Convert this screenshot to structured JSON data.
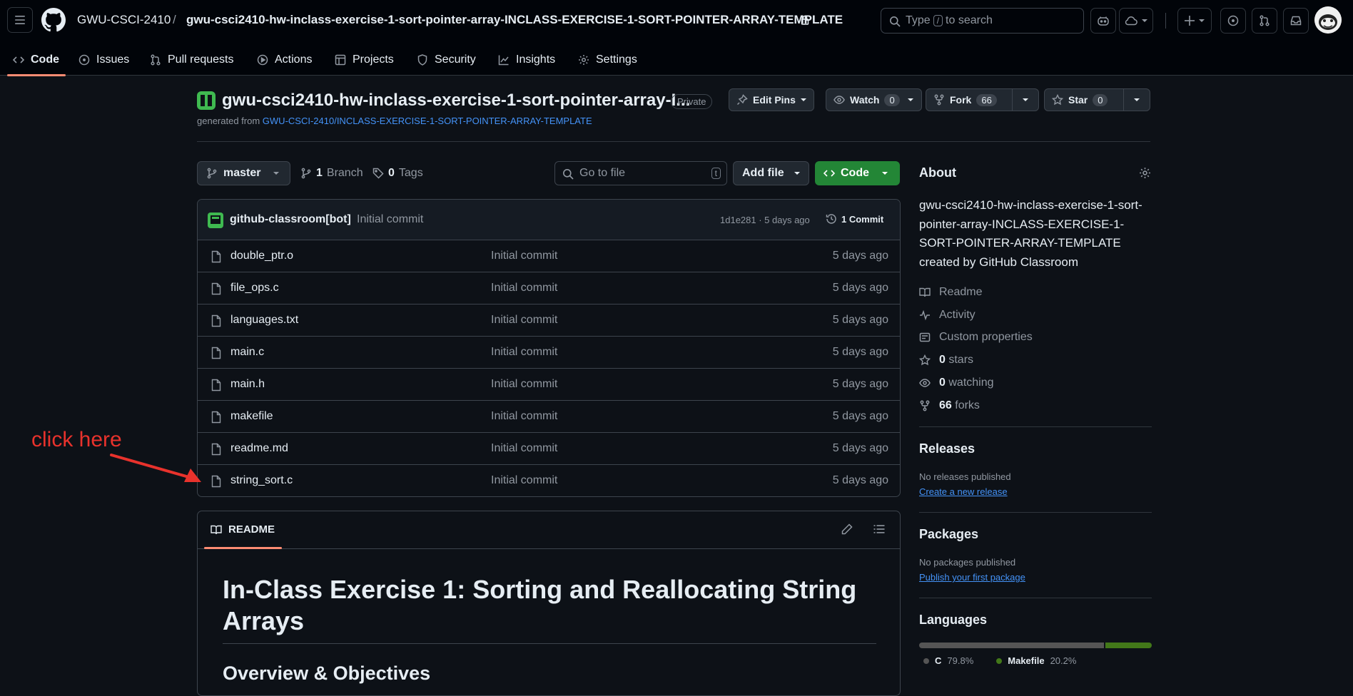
{
  "header": {
    "org": "GWU-CSCI-2410",
    "separator": "/",
    "repo": "gwu-csci2410-hw-inclass-exercise-1-sort-pointer-array-INCLASS-EXERCISE-1-SORT-POINTER-ARRAY-TEMPLATE",
    "search_pre": "Type",
    "search_key": "/",
    "search_post": "to search"
  },
  "nav": {
    "code": "Code",
    "issues": "Issues",
    "pulls": "Pull requests",
    "actions": "Actions",
    "projects": "Projects",
    "security": "Security",
    "insights": "Insights",
    "settings": "Settings"
  },
  "repo": {
    "title": "gwu-csci2410-hw-inclass-exercise-1-sort-pointer-array-I...",
    "visibility": "Private",
    "generated_prefix": "generated from",
    "generated_link": "GWU-CSCI-2410/INCLASS-EXERCISE-1-SORT-POINTER-ARRAY-TEMPLATE",
    "edit_pins": "Edit Pins",
    "watch": "Watch",
    "watch_count": "0",
    "fork": "Fork",
    "fork_count": "66",
    "star": "Star",
    "star_count": "0"
  },
  "toolbar": {
    "branch": "master",
    "branches_count": "1",
    "branches_label": "Branch",
    "tags_count": "0",
    "tags_label": "Tags",
    "goto_placeholder": "Go to file",
    "goto_key": "t",
    "add_file": "Add file",
    "code": "Code"
  },
  "commit": {
    "author": "github-classroom[bot]",
    "message": "Initial commit",
    "hash_time": "1d1e281 · 5 days ago",
    "count": "1 Commit"
  },
  "files": [
    {
      "name": "double_ptr.o",
      "msg": "Initial commit",
      "date": "5 days ago"
    },
    {
      "name": "file_ops.c",
      "msg": "Initial commit",
      "date": "5 days ago"
    },
    {
      "name": "languages.txt",
      "msg": "Initial commit",
      "date": "5 days ago"
    },
    {
      "name": "main.c",
      "msg": "Initial commit",
      "date": "5 days ago"
    },
    {
      "name": "main.h",
      "msg": "Initial commit",
      "date": "5 days ago"
    },
    {
      "name": "makefile",
      "msg": "Initial commit",
      "date": "5 days ago"
    },
    {
      "name": "readme.md",
      "msg": "Initial commit",
      "date": "5 days ago"
    },
    {
      "name": "string_sort.c",
      "msg": "Initial commit",
      "date": "5 days ago"
    }
  ],
  "readme": {
    "tab": "README",
    "h1": "In-Class Exercise 1: Sorting and Reallocating String Arrays",
    "h2": "Overview & Objectives"
  },
  "about": {
    "title": "About",
    "description": "gwu-csci2410-hw-inclass-exercise-1-sort-pointer-array-INCLASS-EXERCISE-1-SORT-POINTER-ARRAY-TEMPLATE created by GitHub Classroom",
    "readme": "Readme",
    "activity": "Activity",
    "custom": "Custom properties",
    "stars_count": "0",
    "stars_label": "stars",
    "watching_count": "0",
    "watching_label": "watching",
    "forks_count": "66",
    "forks_label": "forks"
  },
  "releases": {
    "title": "Releases",
    "none": "No releases published",
    "link": "Create a new release"
  },
  "packages": {
    "title": "Packages",
    "none": "No packages published",
    "link": "Publish your first package"
  },
  "languages": {
    "title": "Languages",
    "items": [
      {
        "name": "C",
        "pct": "79.8%",
        "value": 79.8,
        "color": "#555555"
      },
      {
        "name": "Makefile",
        "pct": "20.2%",
        "value": 20.2,
        "color": "#427819"
      }
    ]
  },
  "annotation": {
    "text": "click here",
    "color": "#e8322c"
  }
}
